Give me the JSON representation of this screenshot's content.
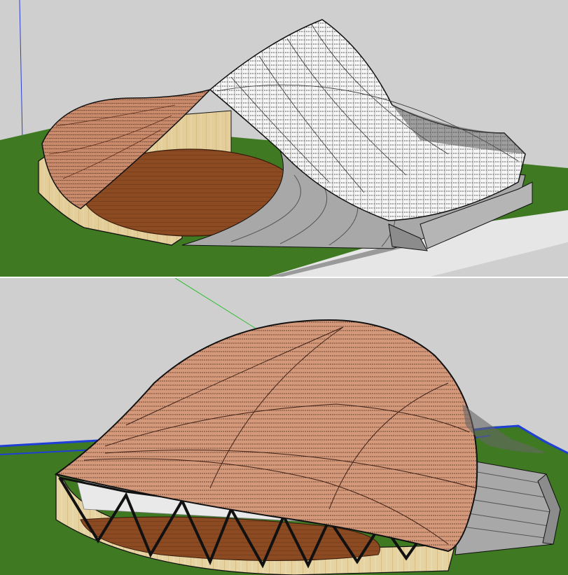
{
  "colors": {
    "sky": "#cfcfcf",
    "grass": "#3f7a22",
    "grass_dark": "#2f5d18",
    "wood_wall": "#e3cd98",
    "wood_wall_line": "#b99b5c",
    "floor_wood": "#8b4a22",
    "floor_wood_light": "#a2592a",
    "shell_terracotta": "#c98a6b",
    "shell_terracotta_dark": "#8d5038",
    "shell_white": "#f4f4f4",
    "seating_grey": "#a8a8a8",
    "seating_grey_dark": "#8c8c8c",
    "edge_blue": "#1f3fd6",
    "axis_green": "#2fbf2f",
    "axis_blue": "#2c3fd0",
    "outline": "#111111"
  },
  "views": [
    {
      "name": "top-perspective-view",
      "shows": [
        "terracotta-shell",
        "white-mesh-canopy",
        "wooden-stage-floor",
        "stepped-seating",
        "timber-perimeter-wall",
        "grass-ground-plane"
      ]
    },
    {
      "name": "bottom-perspective-view",
      "shows": [
        "terracotta-shell",
        "truss-frame",
        "wooden-stage-floor",
        "stepped-seating",
        "timber-perimeter-wall",
        "grass-ground-plane"
      ]
    }
  ]
}
